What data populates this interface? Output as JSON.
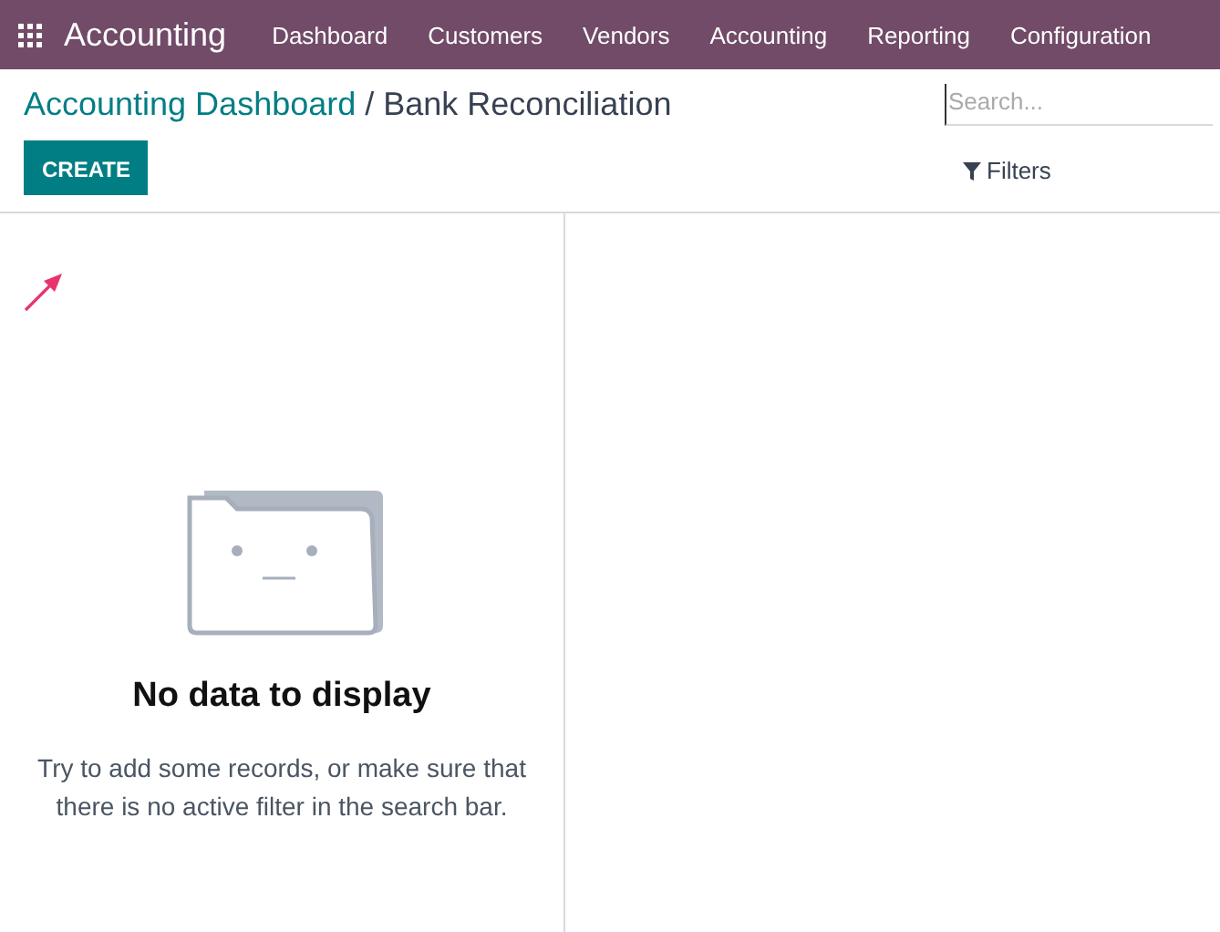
{
  "navbar": {
    "app_name": "Accounting",
    "menu": [
      "Dashboard",
      "Customers",
      "Vendors",
      "Accounting",
      "Reporting",
      "Configuration"
    ]
  },
  "breadcrumb": {
    "parent": "Accounting Dashboard",
    "separator": "/",
    "current": "Bank Reconciliation"
  },
  "create_button": "CREATE",
  "search": {
    "placeholder": "Search..."
  },
  "filters": "Filters",
  "empty_state": {
    "title": "No data to display",
    "message": "Try to add some records, or make sure that there is no active filter in the search bar."
  }
}
